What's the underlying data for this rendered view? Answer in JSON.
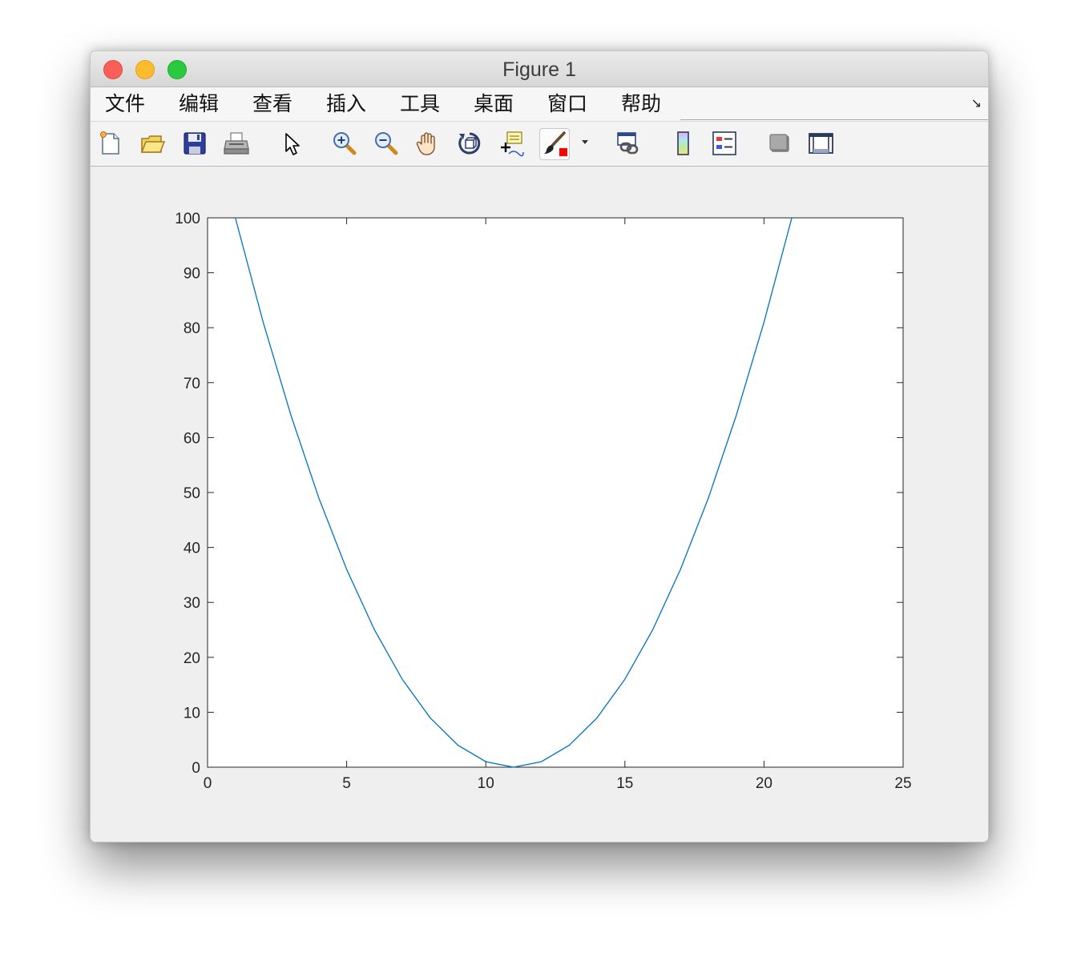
{
  "window": {
    "title": "Figure 1"
  },
  "menu": {
    "items": [
      {
        "key": "file",
        "label": "文件"
      },
      {
        "key": "edit",
        "label": "编辑"
      },
      {
        "key": "view",
        "label": "查看"
      },
      {
        "key": "insert",
        "label": "插入"
      },
      {
        "key": "tools",
        "label": "工具"
      },
      {
        "key": "desktop",
        "label": "桌面"
      },
      {
        "key": "window",
        "label": "窗口"
      },
      {
        "key": "help",
        "label": "帮助"
      }
    ],
    "undock_icon": "undock-arrow-icon"
  },
  "toolbar": {
    "buttons": [
      {
        "name": "new-figure-button",
        "icon": "new-document-icon"
      },
      {
        "name": "open-file-button",
        "icon": "folder-open-icon"
      },
      {
        "name": "save-button",
        "icon": "floppy-disk-icon"
      },
      {
        "name": "print-button",
        "icon": "printer-icon"
      },
      {
        "name": "edit-plot-button",
        "icon": "cursor-arrow-icon"
      },
      {
        "name": "zoom-in-button",
        "icon": "zoom-in-icon"
      },
      {
        "name": "zoom-out-button",
        "icon": "zoom-out-icon"
      },
      {
        "name": "pan-button",
        "icon": "hand-icon"
      },
      {
        "name": "rotate-3d-button",
        "icon": "rotate-3d-icon"
      },
      {
        "name": "data-cursor-button",
        "icon": "data-cursor-icon"
      },
      {
        "name": "brush-button",
        "icon": "brush-icon",
        "pressed": true
      },
      {
        "name": "link-plot-button",
        "icon": "link-plot-icon"
      },
      {
        "name": "insert-colorbar-button",
        "icon": "colorbar-icon"
      },
      {
        "name": "insert-legend-button",
        "icon": "legend-icon"
      },
      {
        "name": "hide-plot-tools-button",
        "icon": "hide-plot-tools-icon"
      },
      {
        "name": "show-plot-tools-button",
        "icon": "show-plot-tools-icon"
      }
    ]
  },
  "chart_data": {
    "type": "line",
    "title": "",
    "xlabel": "",
    "ylabel": "",
    "xlim": [
      0,
      25
    ],
    "ylim": [
      0,
      100
    ],
    "xticks": [
      0,
      5,
      10,
      15,
      20,
      25
    ],
    "yticks": [
      0,
      10,
      20,
      30,
      40,
      50,
      60,
      70,
      80,
      90,
      100
    ],
    "grid": false,
    "series": [
      {
        "color": "#0072bd",
        "x": [
          1,
          2,
          3,
          4,
          5,
          6,
          7,
          8,
          9,
          10,
          11,
          12,
          13,
          14,
          15,
          16,
          17,
          18,
          19,
          20,
          21
        ],
        "y": [
          100,
          81,
          64,
          49,
          36,
          25,
          16,
          9,
          4,
          1,
          0,
          1,
          4,
          9,
          16,
          25,
          36,
          49,
          64,
          81,
          100
        ]
      }
    ]
  }
}
